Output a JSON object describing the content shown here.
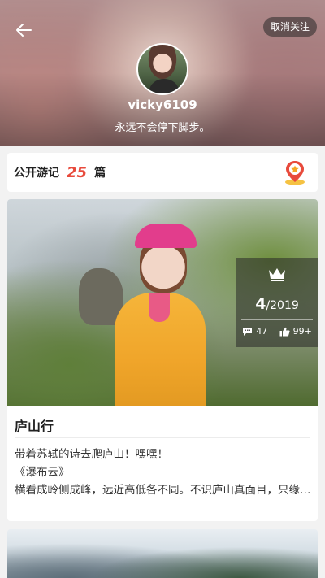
{
  "header": {
    "back_icon": "arrow-left-icon",
    "unfollow_label": "取消关注",
    "username": "vicky6109",
    "motto": "永远不会停下脚步。"
  },
  "summary": {
    "label": "公开游记",
    "count": "25",
    "unit": "篇",
    "icon": "map-pin-star-icon",
    "accent_color": "#e84a3c"
  },
  "posts": [
    {
      "month": "4",
      "year": "/2019",
      "comments": "47",
      "likes": "99+",
      "title": "庐山行",
      "lines": [
        "带着苏轼的诗去爬庐山！嘿嘿！",
        "《瀑布云》",
        "横看成岭侧成峰，远近高低各不同。不识庐山真面目，只缘身在此山中。"
      ]
    }
  ]
}
